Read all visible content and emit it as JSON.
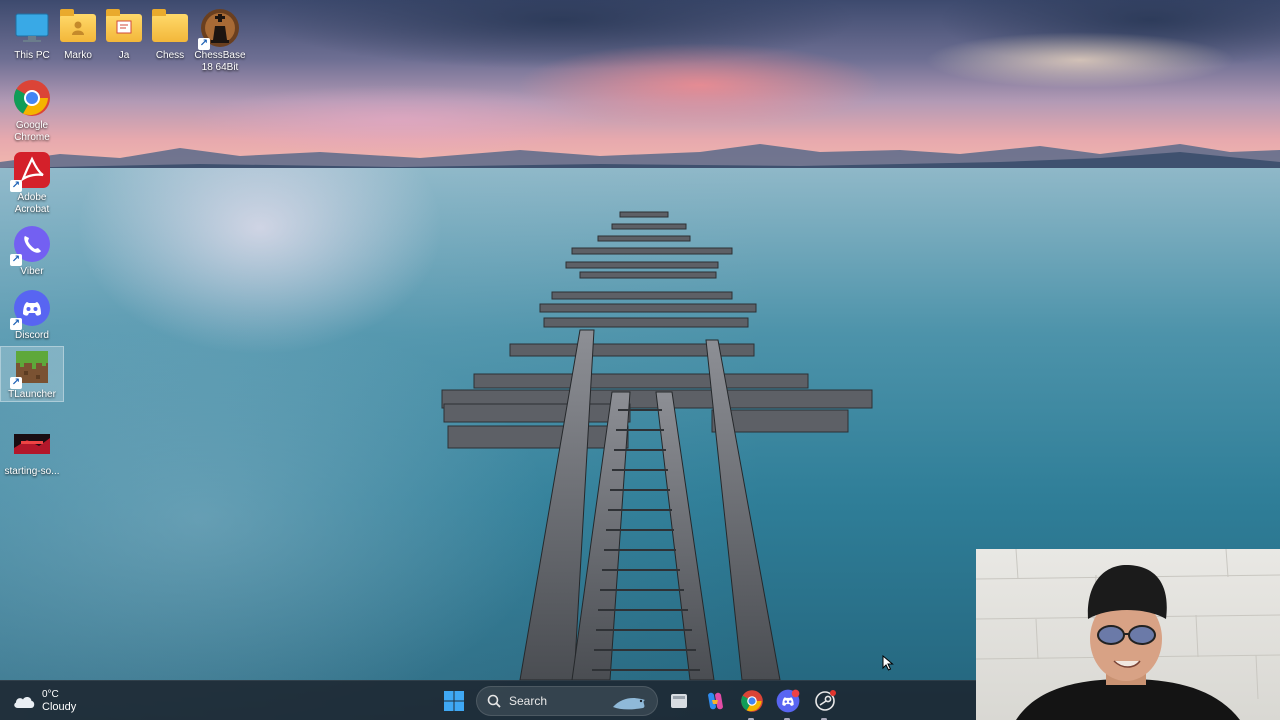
{
  "desktop": {
    "icons": [
      {
        "label": "This PC",
        "icon": "monitor-icon"
      },
      {
        "label": "Marko",
        "icon": "user-folder-icon"
      },
      {
        "label": "Ja",
        "icon": "folder-icon"
      },
      {
        "label": "Chess",
        "icon": "folder-icon"
      },
      {
        "label": "ChessBase 18 64Bit",
        "icon": "chess-king-icon"
      },
      {
        "label": "Google Chrome",
        "icon": "chrome-icon"
      },
      {
        "label": "Adobe Acrobat",
        "icon": "acrobat-icon"
      },
      {
        "label": "Viber",
        "icon": "viber-icon"
      },
      {
        "label": "Discord",
        "icon": "discord-icon"
      },
      {
        "label": "TLauncher",
        "icon": "minecraft-grass-icon"
      },
      {
        "label": "starting-so...",
        "icon": "video-thumbnail-icon"
      }
    ]
  },
  "taskbar": {
    "weather": {
      "temperature": "0°C",
      "condition": "Cloudy"
    },
    "search_placeholder": "Search",
    "apps": [
      "start-icon",
      "task-view-icon",
      "copilot-icon",
      "chrome-icon",
      "discord-icon",
      "steam-icon"
    ]
  },
  "colors": {
    "taskbar_bg": "#1c2630",
    "discord": "#5865F2",
    "viber": "#7360F2",
    "acrobat": "#d4202a",
    "windows_blue": "#3fa8f4"
  }
}
